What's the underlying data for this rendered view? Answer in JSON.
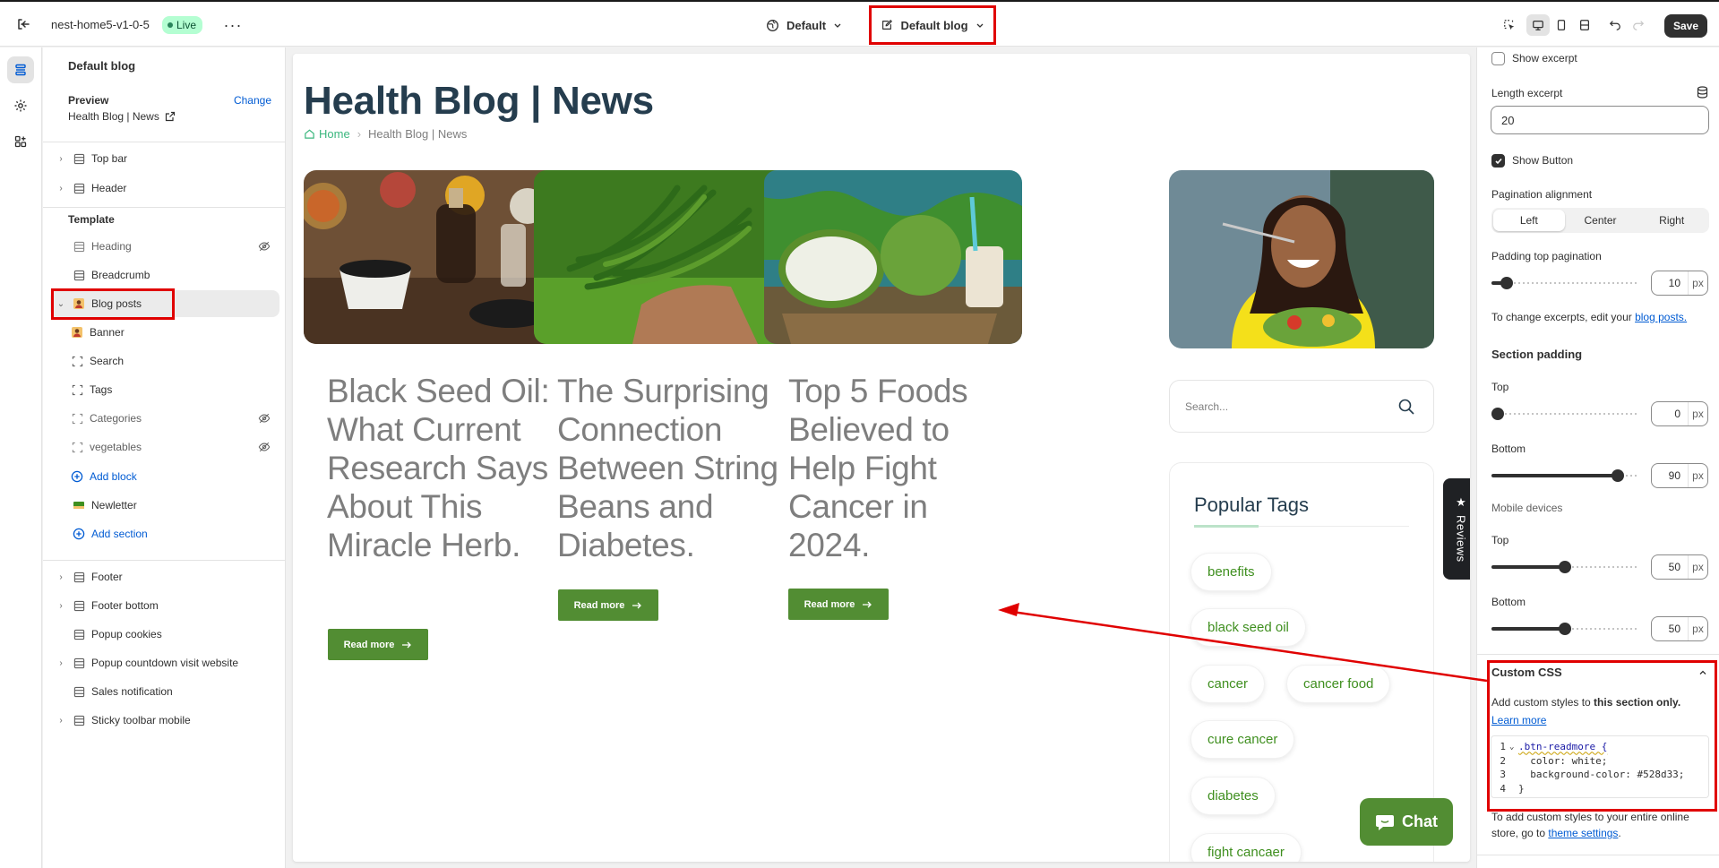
{
  "topbar": {
    "store_name": "nest-home5-v1-0-5",
    "live_badge": "Live",
    "theme_select": "Default",
    "template_select": "Default blog",
    "save_label": "Save"
  },
  "sidebar": {
    "title": "Default blog",
    "preview_label": "Preview",
    "preview_change": "Change",
    "preview_value": "Health Blog | News",
    "top_items": [
      {
        "label": "Top bar"
      },
      {
        "label": "Header"
      }
    ],
    "template_heading": "Template",
    "template_items": [
      {
        "label": "Heading"
      },
      {
        "label": "Breadcrumb"
      },
      {
        "label": "Blog posts"
      }
    ],
    "blocks": [
      {
        "label": "Banner"
      },
      {
        "label": "Search"
      },
      {
        "label": "Tags"
      },
      {
        "label": "Categories"
      },
      {
        "label": "vegetables"
      }
    ],
    "add_block": "Add block",
    "newsletter": "Newletter",
    "add_section": "Add section",
    "footer_items": [
      {
        "label": "Footer"
      },
      {
        "label": "Footer bottom"
      },
      {
        "label": "Popup cookies"
      },
      {
        "label": "Popup countdown visit website"
      },
      {
        "label": "Sales notification"
      },
      {
        "label": "Sticky toolbar mobile"
      }
    ]
  },
  "preview": {
    "page_title": "Health Blog | News",
    "breadcrumb_home": "Home",
    "breadcrumb_current": "Health Blog | News",
    "posts": [
      {
        "title": "Black Seed Oil: What Current Research Says About This Miracle Herb.",
        "read_more": "Read more"
      },
      {
        "title": "The Surprising Connection Between String Beans and Diabetes.",
        "read_more": "Read more"
      },
      {
        "title": "Top 5 Foods Believed to Help Fight Cancer in 2024.",
        "read_more": "Read more"
      }
    ],
    "search_placeholder": "Search...",
    "popular_tags_title": "Popular Tags",
    "tags": [
      "benefits",
      "black seed oil",
      "cancer",
      "cancer food",
      "cure cancer",
      "diabetes",
      "fight cancaer"
    ],
    "reviews_tab": "Reviews",
    "chat_label": "Chat"
  },
  "settings": {
    "show_excerpt": "Show excerpt",
    "length_excerpt_label": "Length excerpt",
    "length_excerpt_value": "20",
    "show_button": "Show Button",
    "pagination_alignment_label": "Pagination alignment",
    "pagination_options": [
      "Left",
      "Center",
      "Right"
    ],
    "pagination_selected": "Left",
    "padding_top_pagination_label": "Padding top pagination",
    "padding_top_pagination_value": "10",
    "unit": "px",
    "excerpt_help_prefix": "To change excerpts, edit your ",
    "excerpt_help_link": "blog posts.",
    "section_padding_heading": "Section padding",
    "top_label": "Top",
    "top_value": "0",
    "bottom_label": "Bottom",
    "bottom_value": "90",
    "mobile_devices_label": "Mobile devices",
    "mobile_top_label": "Top",
    "mobile_top_value": "50",
    "mobile_bottom_label": "Bottom",
    "mobile_bottom_value": "50",
    "custom_css_heading": "Custom CSS",
    "custom_css_help_prefix": "Add custom styles to ",
    "custom_css_help_bold": "this section only.",
    "learn_more": "Learn more",
    "code_lines": [
      {
        "n": "1",
        "text": ".btn-readmore {"
      },
      {
        "n": "2",
        "text": "  color: white;"
      },
      {
        "n": "3",
        "text": "  background-color: #528d33;"
      },
      {
        "n": "4",
        "text": "}"
      }
    ],
    "store_help_prefix": "To add custom styles to your entire online store, go to ",
    "store_help_link": "theme settings",
    "store_help_suffix": "."
  },
  "colors": {
    "accent_green": "#528d33",
    "annotation_red": "#e00000",
    "title_navy": "#253d4e"
  },
  "icons": [
    "exit-icon",
    "more-icon",
    "globe-icon",
    "edit-icon",
    "chevron-down-icon",
    "inspector-icon",
    "desktop-icon",
    "mobile-icon",
    "fullwidth-icon",
    "undo-icon",
    "redo-icon",
    "sections-icon",
    "settings-icon",
    "apps-icon",
    "eye-off-icon",
    "external-link-icon",
    "home-icon",
    "search-icon",
    "star-icon",
    "chat-icon",
    "arrow-right-icon",
    "database-icon",
    "checkmark-icon",
    "plus-circle-icon"
  ]
}
